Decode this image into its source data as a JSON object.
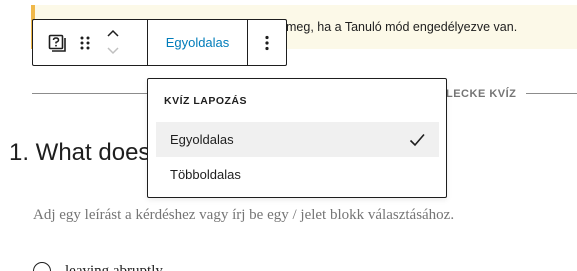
{
  "notice": {
    "text": "meg, ha a Tanuló mód engedélyezve van.",
    "accent_color": "#f0b849",
    "background": "#fcf9e8"
  },
  "toolbar": {
    "block_icon": "quiz-block-icon",
    "drag_icon": "drag-handle-icon",
    "move_up_icon": "chevron-up-icon",
    "move_down_icon": "chevron-down-icon",
    "mode_label": "Egyoldalas",
    "more_icon": "vertical-ellipsis-icon",
    "accent_color": "#007cba"
  },
  "separator": {
    "label": "LECKE KVÍZ"
  },
  "question": {
    "title": "1. What does",
    "description": "Adj egy leírást a kérdéshez vagy írj be egy / jelet blokk választásához.",
    "answer_text": "leaving abruptly"
  },
  "dropdown": {
    "heading": "KVÍZ LAPOZÁS",
    "items": [
      {
        "label": "Egyoldalas",
        "selected": true
      },
      {
        "label": "Többoldalas",
        "selected": false
      }
    ],
    "check_icon": "check-icon"
  }
}
